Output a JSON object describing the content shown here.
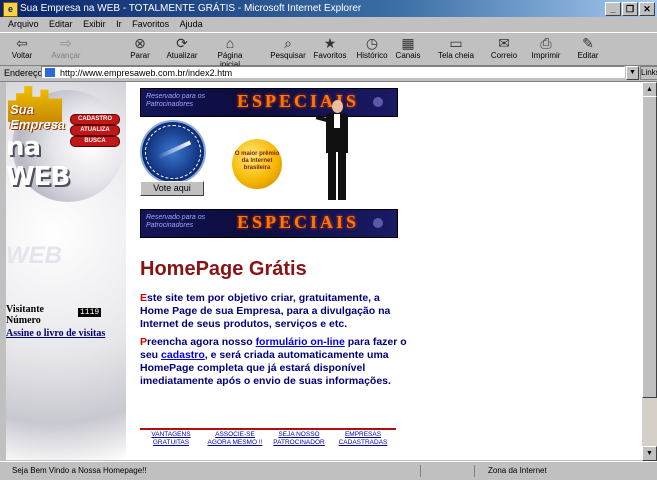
{
  "window": {
    "title": "Sua Empresa na WEB - TOTALMENTE GRÁTIS - Microsoft Internet Explorer",
    "controls": [
      "_",
      "❐",
      "✕"
    ]
  },
  "menu": [
    "Arquivo",
    "Editar",
    "Exibir",
    "Ir",
    "Favoritos",
    "Ajuda"
  ],
  "toolbar": [
    {
      "label": "Voltar",
      "glyph": "⇦",
      "enabled": true
    },
    {
      "label": "Avançar",
      "glyph": "⇨",
      "enabled": false
    },
    {
      "label": "Parar",
      "glyph": "⊗",
      "enabled": true
    },
    {
      "label": "Atualizar",
      "glyph": "⟳",
      "enabled": true
    },
    {
      "label": "Página inicial",
      "glyph": "⌂",
      "enabled": true
    },
    {
      "label": "Pesquisar",
      "glyph": "⌕",
      "enabled": true
    },
    {
      "label": "Favoritos",
      "glyph": "★",
      "enabled": true
    },
    {
      "label": "Histórico",
      "glyph": "◷",
      "enabled": true
    },
    {
      "label": "Canais",
      "glyph": "▦",
      "enabled": true
    },
    {
      "label": "Tela cheia",
      "glyph": "▭",
      "enabled": true
    },
    {
      "label": "Correio",
      "glyph": "✉",
      "enabled": true
    },
    {
      "label": "Imprimir",
      "glyph": "⎙",
      "enabled": true
    },
    {
      "label": "Editar",
      "glyph": "✎",
      "enabled": true
    }
  ],
  "address": {
    "label": "Endereço",
    "url": "http://www.empresaweb.com.br/index2.htm",
    "links": "Links"
  },
  "logo": {
    "sua": "Sua Empresa",
    "web": "na WEB"
  },
  "side_buttons": [
    "CADASTRO",
    "ATUALIZA",
    "BUSCA"
  ],
  "faded_text": "WEB",
  "visitor": {
    "label1": "Visitante",
    "label2": "Número",
    "count": "1119",
    "guestbook": "Assine o livro de visitas"
  },
  "banner": {
    "reserved": "Reservado para os Patrocinadores",
    "title": "ESPECIAIS"
  },
  "vote": {
    "label": "Vote aqui"
  },
  "prize": {
    "text": "O maior prêmio da Internet brasileira"
  },
  "heading": "HomePage Grátis",
  "para1": {
    "cap": "E",
    "rest": "ste site tem por objetivo criar, gratuitamente, a Home Page de sua Empresa, para a divulgação na Internet de seus produtos, serviços e etc."
  },
  "para2": {
    "cap": "P",
    "a": "reencha agora nosso ",
    "link1": "formulário on-line",
    "b": " para fazer o seu ",
    "link2": "cadastro",
    "c": ", e será criada automaticamente uma HomePage completa que já estará disponível imediatamente após o envio de suas informações."
  },
  "footer_links": [
    {
      "l1": "VANTAGENS",
      "l2": "GRATUITAS"
    },
    {
      "l1": "ASSOCIE-SE",
      "l2": "AGORA MESMO !!"
    },
    {
      "l1": "SEJA NOSSO",
      "l2": "PATROCINADOR"
    },
    {
      "l1": "EMPRESAS",
      "l2": "CADASTRADAS"
    }
  ],
  "status": {
    "message": "Seja Bem Vindo a Nossa Homepage!!",
    "zone": "Zona da Internet"
  }
}
